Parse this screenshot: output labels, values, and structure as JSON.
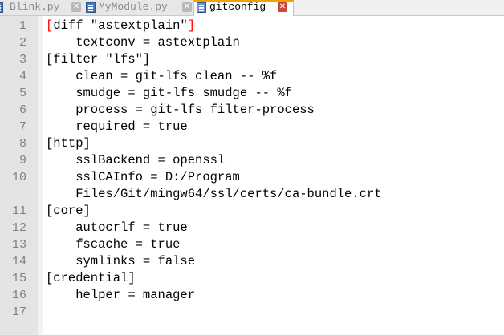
{
  "tabs": [
    {
      "label": "Blink.py",
      "active": false
    },
    {
      "label": "MyModule.py",
      "active": false
    },
    {
      "label": "gitconfig",
      "active": true
    }
  ],
  "icons": {
    "file": "file-icon",
    "close": "close-icon",
    "close_glyph": "✕"
  },
  "colors": {
    "active_tab_accent": "#f5a000",
    "active_close": "#c8473c",
    "brace_highlight": "#ff0000",
    "gutter": "#e4e4e4",
    "line_number": "#808080"
  },
  "editor": {
    "lines": [
      {
        "num": "1",
        "text": "[diff \"astextplain\"]"
      },
      {
        "num": "2",
        "text": "    textconv = astextplain"
      },
      {
        "num": "3",
        "text": "[filter \"lfs\"]"
      },
      {
        "num": "4",
        "text": "    clean = git-lfs clean -- %f"
      },
      {
        "num": "5",
        "text": "    smudge = git-lfs smudge -- %f"
      },
      {
        "num": "6",
        "text": "    process = git-lfs filter-process"
      },
      {
        "num": "7",
        "text": "    required = true"
      },
      {
        "num": "8",
        "text": "[http]"
      },
      {
        "num": "9",
        "text": "    sslBackend = openssl"
      },
      {
        "num": "10",
        "text": "    sslCAInfo = D:/Program"
      },
      {
        "num": "",
        "text": "    Files/Git/mingw64/ssl/certs/ca-bundle.crt"
      },
      {
        "num": "11",
        "text": "[core]"
      },
      {
        "num": "12",
        "text": "    autocrlf = true"
      },
      {
        "num": "13",
        "text": "    fscache = true"
      },
      {
        "num": "14",
        "text": "    symlinks = false"
      },
      {
        "num": "15",
        "text": "[credential]"
      },
      {
        "num": "16",
        "text": "    helper = manager"
      },
      {
        "num": "17",
        "text": ""
      }
    ],
    "line1_parts": {
      "open": "[",
      "middle": "diff \"astextplain\"",
      "close": "]"
    }
  }
}
